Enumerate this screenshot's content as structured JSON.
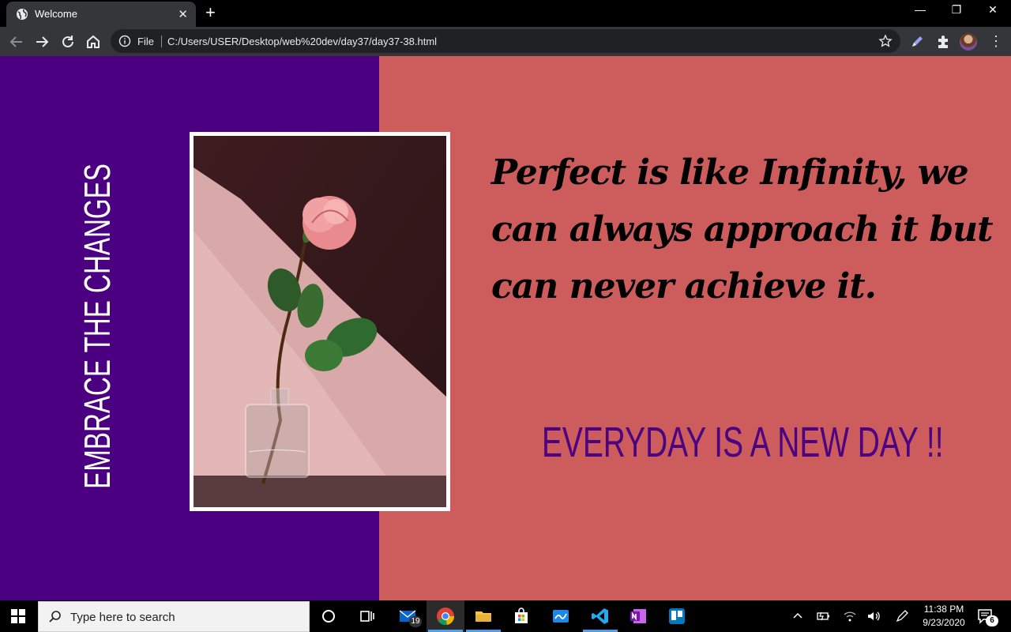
{
  "browser": {
    "tab_title": "Welcome",
    "new_tab_label": "+",
    "close_tab_label": "✕",
    "url_scheme": "File",
    "url": "C:/Users/USER/Desktop/web%20dev/day37/day37-38.html",
    "window_controls": {
      "minimize": "—",
      "restore": "❐",
      "close": "✕"
    },
    "menu_label": "⋮"
  },
  "page": {
    "vertical_heading": "EMBRACE THE CHANGES",
    "quote": "Perfect is like Infinity, we can always approach it but can never achieve it.",
    "tagline": "EVERYDAY IS A NEW DAY !!",
    "colors": {
      "left_panel": "#4b0082",
      "right_panel": "#cd5c5c",
      "tagline": "#4b0082",
      "heading": "#ffffff"
    },
    "photo_subject": "pink rose in a glass vase"
  },
  "taskbar": {
    "search_placeholder": "Type here to search",
    "apps": [
      "cortana",
      "task-view",
      "mail",
      "chrome",
      "file-explorer",
      "store",
      "whiteboard",
      "vscode",
      "onenote",
      "trello"
    ],
    "mail_badge": "19",
    "clock_time": "11:38 PM",
    "clock_date": "9/23/2020",
    "notification_count": "6"
  }
}
